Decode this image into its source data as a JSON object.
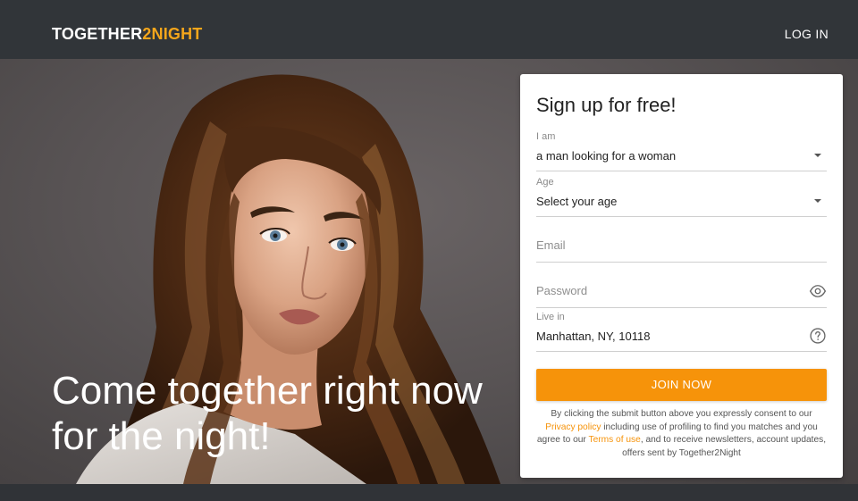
{
  "header": {
    "logo_main": "TOGETHER",
    "logo_accent": "2NIGHT",
    "login_label": "LOG IN"
  },
  "hero": {
    "headline_line1": "Come together right now",
    "headline_line2": "for the night!"
  },
  "signup": {
    "title": "Sign up for free!",
    "fields": {
      "i_am": {
        "label": "I am",
        "value": "a man looking for a woman"
      },
      "age": {
        "label": "Age",
        "value": "Select your age"
      },
      "email": {
        "placeholder": "Email"
      },
      "password": {
        "placeholder": "Password"
      },
      "live_in": {
        "label": "Live in",
        "value": "Manhattan, NY, 10118"
      }
    },
    "join_label": "JOIN NOW",
    "legal": {
      "part1": "By clicking the submit button above you expressly consent to our",
      "privacy_link": "Privacy policy",
      "part2": " including use of profiling to find you matches and you agree to our ",
      "terms_link": "Terms of use",
      "part3": ", and to receive newsletters, account updates, offers sent by Together2Night"
    }
  },
  "icons": {
    "password_toggle": "eye-icon",
    "location_help": "help-circle-icon",
    "select_caret": "caret-down-icon"
  },
  "colors": {
    "header_bg": "#313539",
    "brand_accent": "#f5a61b",
    "cta": "#f6930a",
    "card_bg": "#ffffff"
  }
}
